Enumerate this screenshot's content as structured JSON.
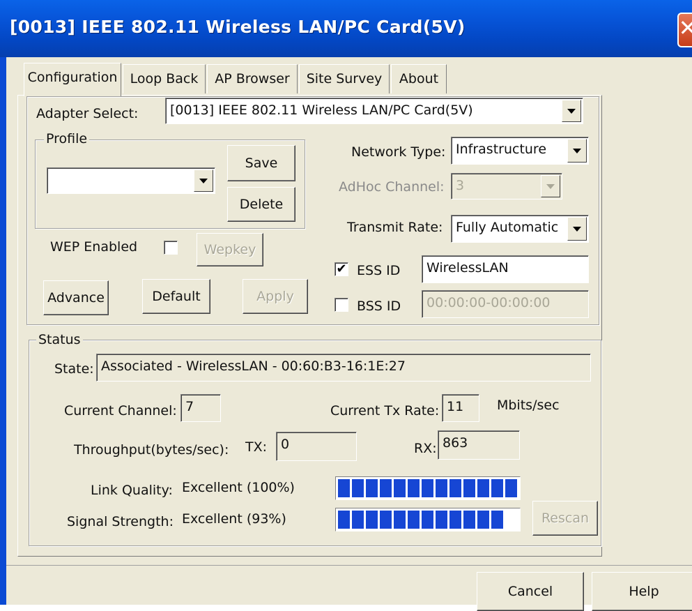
{
  "window": {
    "title": "[0013] IEEE 802.11 Wireless LAN/PC Card(5V)",
    "close_glyph": "✕"
  },
  "tabs": [
    {
      "label": "Configuration",
      "active": true
    },
    {
      "label": "Loop Back"
    },
    {
      "label": "AP Browser"
    },
    {
      "label": "Site Survey"
    },
    {
      "label": "About"
    }
  ],
  "config": {
    "adapter_label": "Adapter Select:",
    "adapter_value": "[0013] IEEE 802.11 Wireless LAN/PC Card(5V)",
    "profile_legend": "Profile",
    "profile_value": "",
    "save_label": "Save",
    "delete_label": "Delete",
    "network_type_label": "Network Type:",
    "network_type_value": "Infrastructure",
    "adhoc_channel_label": "AdHoc Channel:",
    "adhoc_channel_value": "3",
    "transmit_rate_label": "Transmit Rate:",
    "transmit_rate_value": "Fully Automatic",
    "wep_label": "WEP Enabled",
    "wep_checked": false,
    "wepkey_label": "Wepkey",
    "essid_label": "ESS ID",
    "essid_checked": true,
    "essid_value": "WirelessLAN",
    "bssid_label": "BSS ID",
    "bssid_checked": false,
    "bssid_value": "00:00:00-00:00:00",
    "advance_label": "Advance",
    "default_label": "Default",
    "apply_label": "Apply"
  },
  "status": {
    "legend": "Status",
    "state_label": "State:",
    "state_value": "Associated - WirelessLAN - 00:60:B3-16:1E:27",
    "channel_label": "Current Channel:",
    "channel_value": "7",
    "tx_rate_label": "Current Tx Rate:",
    "tx_rate_value": "11",
    "tx_rate_unit": "Mbits/sec",
    "throughput_label": "Throughput(bytes/sec):",
    "tx_label": "TX:",
    "tx_value": "0",
    "rx_label": "RX:",
    "rx_value": "863",
    "link_quality_label": "Link Quality:",
    "link_quality_value": "Excellent (100%)",
    "link_quality_percent": 100,
    "signal_strength_label": "Signal Strength:",
    "signal_strength_value": "Excellent (93%)",
    "signal_strength_percent": 93,
    "rescan_label": "Rescan"
  },
  "footer": {
    "cancel_label": "Cancel",
    "help_label": "Help"
  },
  "colors": {
    "title_bar": "#0754d8",
    "dialog_face": "#ece9d8",
    "meter_fill": "#1646d4",
    "close_button": "#d4532f"
  }
}
